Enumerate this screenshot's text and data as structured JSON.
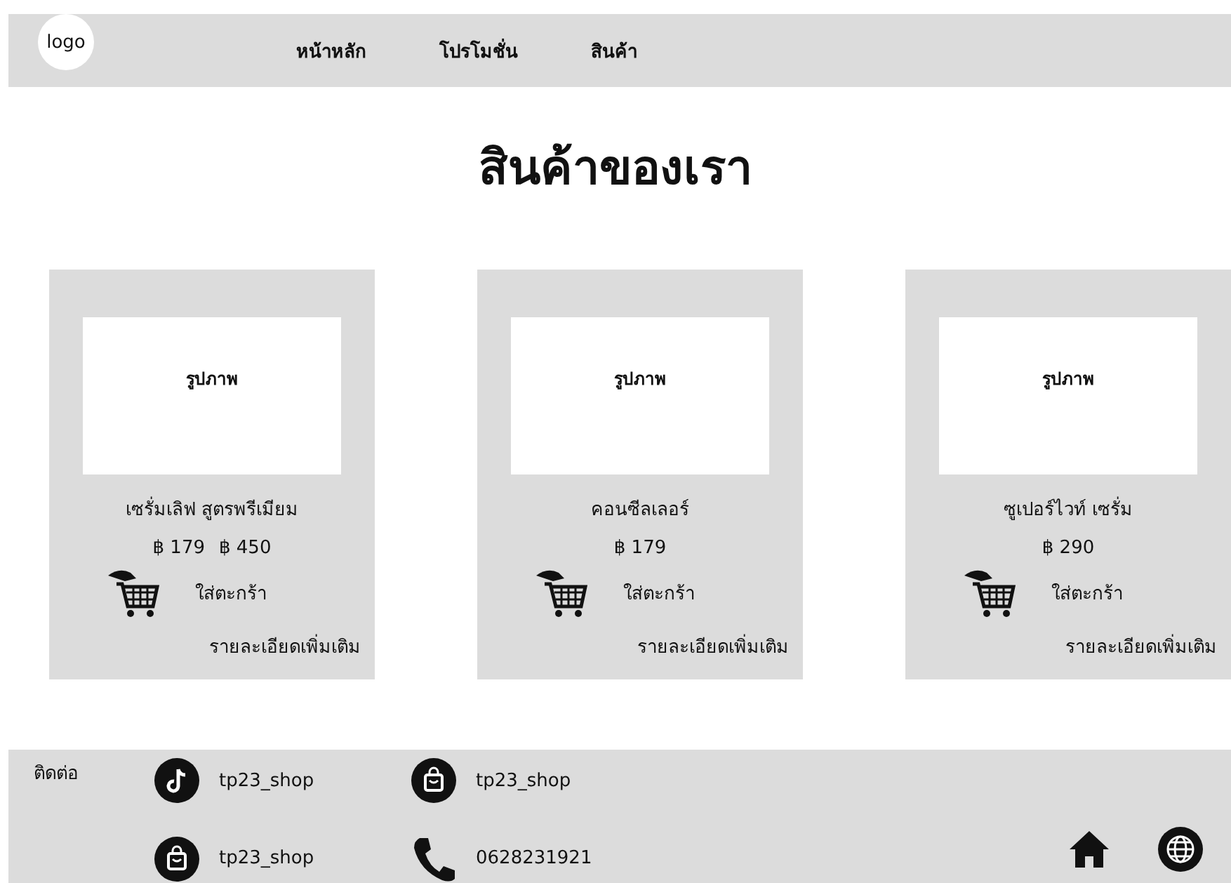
{
  "header": {
    "logo": "logo",
    "nav": [
      "หน้าหลัก",
      "โปรโมชั่น",
      "สินค้า"
    ]
  },
  "title": "สินค้าของเรา",
  "products": [
    {
      "image_label": "รูปภาพ",
      "name": "เซรั่มเลิฟ สูตรพรีเมียม",
      "prices": [
        "฿ 179",
        "฿ 450"
      ],
      "cart": "ใส่ตะกร้า",
      "details": "รายละเอียดเพิ่มเติม"
    },
    {
      "image_label": "รูปภาพ",
      "name": "คอนซีลเลอร์",
      "prices": [
        "฿ 179"
      ],
      "cart": "ใส่ตะกร้า",
      "details": "รายละเอียดเพิ่มเติม"
    },
    {
      "image_label": "รูปภาพ",
      "name": "ซูเปอร์ไวท์ เซรั่ม",
      "prices": [
        "฿ 290"
      ],
      "cart": "ใส่ตะกร้า",
      "details": "รายละเอียดเพิ่มเติม"
    }
  ],
  "footer": {
    "label": "ติดต่อ",
    "contacts": [
      {
        "kind": "tiktok",
        "text": "tp23_shop"
      },
      {
        "kind": "bag",
        "text": "tp23_shop"
      },
      {
        "kind": "bag",
        "text": "tp23_shop"
      },
      {
        "kind": "phone",
        "text": "0628231921"
      }
    ]
  }
}
